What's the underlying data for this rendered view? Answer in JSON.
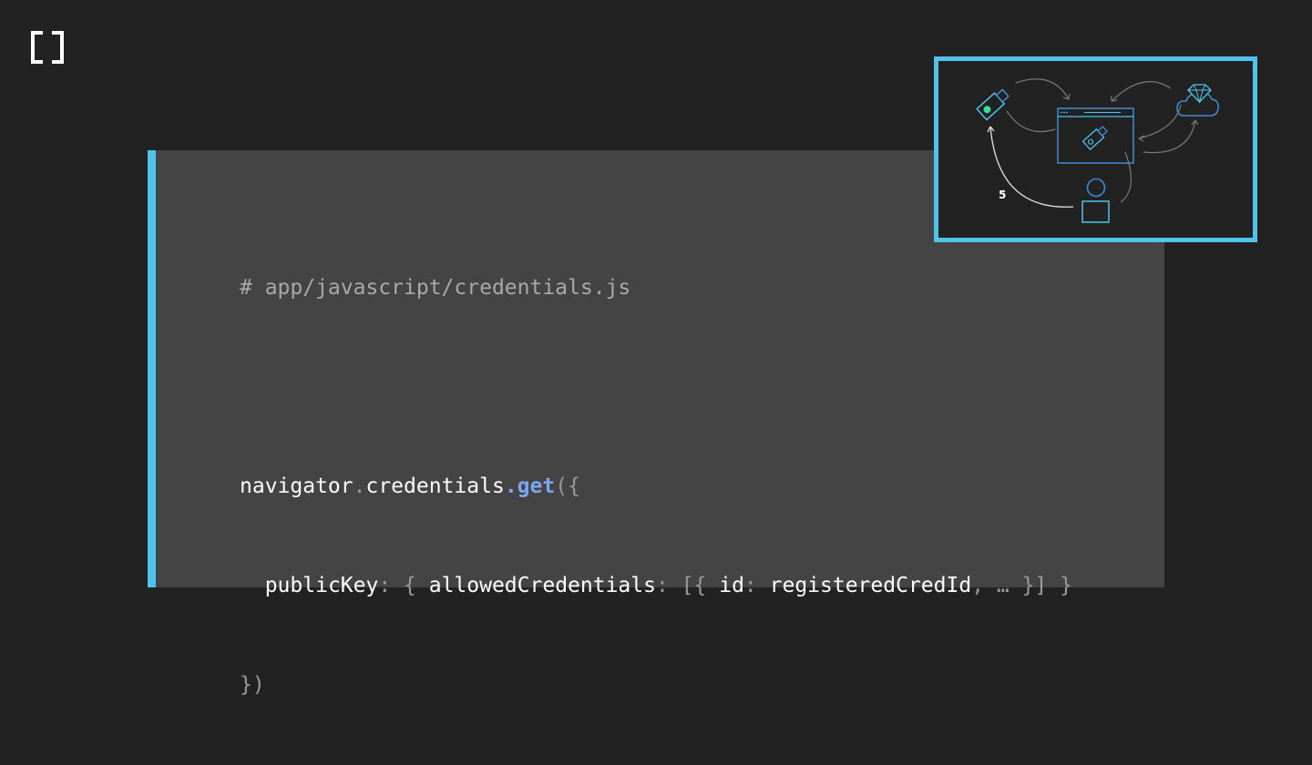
{
  "logo": {
    "icon": "bracket-logo-icon"
  },
  "code": {
    "comment": "# app/javascript/credentials.js",
    "line1": {
      "obj": "navigator",
      "dot1": ".",
      "prop": "credentials",
      "dot2": ".",
      "method": "get",
      "open": "({"
    },
    "line2": {
      "indent": "  ",
      "key1": "publicKey",
      "colon1": ": { ",
      "key2": "allowedCredentials",
      "colon2": ": [{ ",
      "key3": "id",
      "colon3": ": ",
      "value": "registeredCredId",
      "rest": ", … }] }"
    },
    "line3": {
      "close": "})"
    }
  },
  "thumbnail": {
    "step_label": "5",
    "accent_color": "#4fc3ea",
    "secondary_color": "#3a8fd6",
    "dot_color": "#3ddc97"
  }
}
